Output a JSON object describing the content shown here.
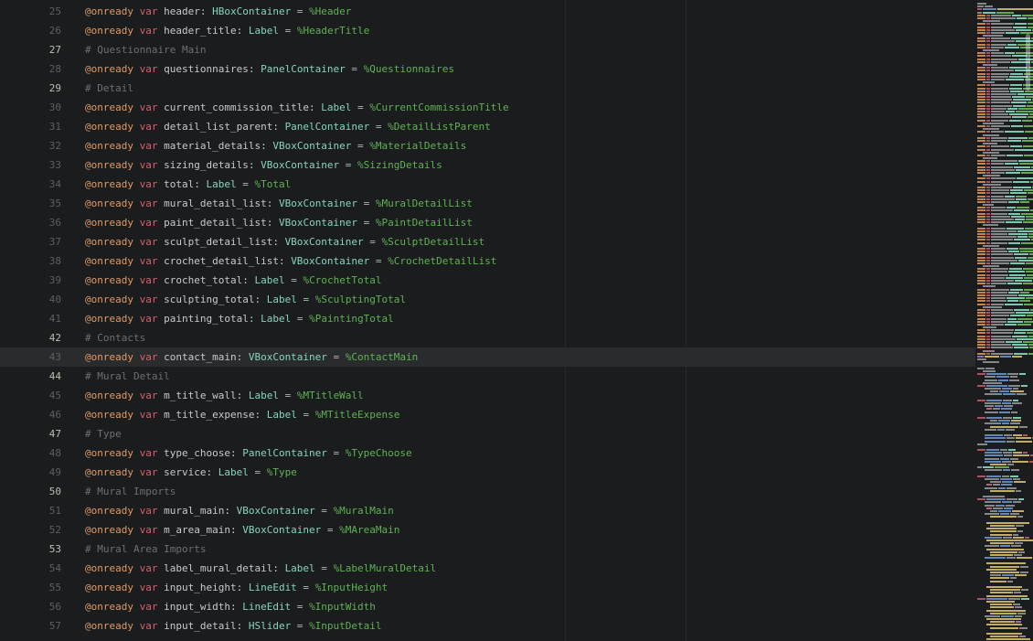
{
  "editor": {
    "current_line": 43,
    "lines": [
      {
        "n": 25,
        "tokens": [
          [
            "a",
            "@onready "
          ],
          [
            "k",
            "var "
          ],
          [
            "i",
            "header: "
          ],
          [
            "t",
            "HBoxContainer"
          ],
          [
            "o",
            " = "
          ],
          [
            "r",
            "%Header"
          ]
        ]
      },
      {
        "n": 26,
        "tokens": [
          [
            "a",
            "@onready "
          ],
          [
            "k",
            "var "
          ],
          [
            "i",
            "header_title: "
          ],
          [
            "t",
            "Label"
          ],
          [
            "o",
            " = "
          ],
          [
            "r",
            "%HeaderTitle"
          ]
        ]
      },
      {
        "n": 27,
        "tokens": [
          [
            "m",
            "# Questionnaire Main"
          ]
        ]
      },
      {
        "n": 28,
        "tokens": [
          [
            "a",
            "@onready "
          ],
          [
            "k",
            "var "
          ],
          [
            "i",
            "questionnaires: "
          ],
          [
            "t",
            "PanelContainer"
          ],
          [
            "o",
            " = "
          ],
          [
            "r",
            "%Questionnaires"
          ]
        ]
      },
      {
        "n": 29,
        "tokens": [
          [
            "m",
            "# Detail"
          ]
        ]
      },
      {
        "n": 30,
        "tokens": [
          [
            "a",
            "@onready "
          ],
          [
            "k",
            "var "
          ],
          [
            "i",
            "current_commission_title: "
          ],
          [
            "t",
            "Label"
          ],
          [
            "o",
            " = "
          ],
          [
            "r",
            "%CurrentCommissionTitle"
          ]
        ]
      },
      {
        "n": 31,
        "tokens": [
          [
            "a",
            "@onready "
          ],
          [
            "k",
            "var "
          ],
          [
            "i",
            "detail_list_parent: "
          ],
          [
            "t",
            "PanelContainer"
          ],
          [
            "o",
            " = "
          ],
          [
            "r",
            "%DetailListParent"
          ]
        ]
      },
      {
        "n": 32,
        "tokens": [
          [
            "a",
            "@onready "
          ],
          [
            "k",
            "var "
          ],
          [
            "i",
            "material_details: "
          ],
          [
            "t",
            "VBoxContainer"
          ],
          [
            "o",
            " = "
          ],
          [
            "r",
            "%MaterialDetails"
          ]
        ]
      },
      {
        "n": 33,
        "tokens": [
          [
            "a",
            "@onready "
          ],
          [
            "k",
            "var "
          ],
          [
            "i",
            "sizing_details: "
          ],
          [
            "t",
            "VBoxContainer"
          ],
          [
            "o",
            " = "
          ],
          [
            "r",
            "%SizingDetails"
          ]
        ]
      },
      {
        "n": 34,
        "tokens": [
          [
            "a",
            "@onready "
          ],
          [
            "k",
            "var "
          ],
          [
            "i",
            "total: "
          ],
          [
            "t",
            "Label"
          ],
          [
            "o",
            " = "
          ],
          [
            "r",
            "%Total"
          ]
        ]
      },
      {
        "n": 35,
        "tokens": [
          [
            "a",
            "@onready "
          ],
          [
            "k",
            "var "
          ],
          [
            "i",
            "mural_detail_list: "
          ],
          [
            "t",
            "VBoxContainer"
          ],
          [
            "o",
            " = "
          ],
          [
            "r",
            "%MuralDetailList"
          ]
        ]
      },
      {
        "n": 36,
        "tokens": [
          [
            "a",
            "@onready "
          ],
          [
            "k",
            "var "
          ],
          [
            "i",
            "paint_detail_list: "
          ],
          [
            "t",
            "VBoxContainer"
          ],
          [
            "o",
            " = "
          ],
          [
            "r",
            "%PaintDetailList"
          ]
        ]
      },
      {
        "n": 37,
        "tokens": [
          [
            "a",
            "@onready "
          ],
          [
            "k",
            "var "
          ],
          [
            "i",
            "sculpt_detail_list: "
          ],
          [
            "t",
            "VBoxContainer"
          ],
          [
            "o",
            " = "
          ],
          [
            "r",
            "%SculptDetailList"
          ]
        ]
      },
      {
        "n": 38,
        "tokens": [
          [
            "a",
            "@onready "
          ],
          [
            "k",
            "var "
          ],
          [
            "i",
            "crochet_detail_list: "
          ],
          [
            "t",
            "VBoxContainer"
          ],
          [
            "o",
            " = "
          ],
          [
            "r",
            "%CrochetDetailList"
          ]
        ]
      },
      {
        "n": 39,
        "tokens": [
          [
            "a",
            "@onready "
          ],
          [
            "k",
            "var "
          ],
          [
            "i",
            "crochet_total: "
          ],
          [
            "t",
            "Label"
          ],
          [
            "o",
            " = "
          ],
          [
            "r",
            "%CrochetTotal"
          ]
        ]
      },
      {
        "n": 40,
        "tokens": [
          [
            "a",
            "@onready "
          ],
          [
            "k",
            "var "
          ],
          [
            "i",
            "sculpting_total: "
          ],
          [
            "t",
            "Label"
          ],
          [
            "o",
            " = "
          ],
          [
            "r",
            "%SculptingTotal"
          ]
        ]
      },
      {
        "n": 41,
        "tokens": [
          [
            "a",
            "@onready "
          ],
          [
            "k",
            "var "
          ],
          [
            "i",
            "painting_total: "
          ],
          [
            "t",
            "Label"
          ],
          [
            "o",
            " = "
          ],
          [
            "r",
            "%PaintingTotal"
          ]
        ]
      },
      {
        "n": 42,
        "tokens": [
          [
            "m",
            "# Contacts"
          ]
        ]
      },
      {
        "n": 43,
        "tokens": [
          [
            "a",
            "@onready "
          ],
          [
            "k",
            "var "
          ],
          [
            "i",
            "contact_main: "
          ],
          [
            "t",
            "VBoxContainer"
          ],
          [
            "o",
            " = "
          ],
          [
            "r",
            "%ContactMain"
          ]
        ]
      },
      {
        "n": 44,
        "tokens": [
          [
            "m",
            "# Mural Detail"
          ]
        ]
      },
      {
        "n": 45,
        "tokens": [
          [
            "a",
            "@onready "
          ],
          [
            "k",
            "var "
          ],
          [
            "i",
            "m_title_wall: "
          ],
          [
            "t",
            "Label"
          ],
          [
            "o",
            " = "
          ],
          [
            "r",
            "%MTitleWall"
          ]
        ]
      },
      {
        "n": 46,
        "tokens": [
          [
            "a",
            "@onready "
          ],
          [
            "k",
            "var "
          ],
          [
            "i",
            "m_title_expense: "
          ],
          [
            "t",
            "Label"
          ],
          [
            "o",
            " = "
          ],
          [
            "r",
            "%MTitleExpense"
          ]
        ]
      },
      {
        "n": 47,
        "tokens": [
          [
            "m",
            "# Type"
          ]
        ]
      },
      {
        "n": 48,
        "tokens": [
          [
            "a",
            "@onready "
          ],
          [
            "k",
            "var "
          ],
          [
            "i",
            "type_choose: "
          ],
          [
            "t",
            "PanelContainer"
          ],
          [
            "o",
            " = "
          ],
          [
            "r",
            "%TypeChoose"
          ]
        ]
      },
      {
        "n": 49,
        "tokens": [
          [
            "a",
            "@onready "
          ],
          [
            "k",
            "var "
          ],
          [
            "i",
            "service: "
          ],
          [
            "t",
            "Label"
          ],
          [
            "o",
            " = "
          ],
          [
            "r",
            "%Type"
          ]
        ]
      },
      {
        "n": 50,
        "tokens": [
          [
            "m",
            "# Mural Imports"
          ]
        ]
      },
      {
        "n": 51,
        "tokens": [
          [
            "a",
            "@onready "
          ],
          [
            "k",
            "var "
          ],
          [
            "i",
            "mural_main: "
          ],
          [
            "t",
            "VBoxContainer"
          ],
          [
            "o",
            " = "
          ],
          [
            "r",
            "%MuralMain"
          ]
        ]
      },
      {
        "n": 52,
        "tokens": [
          [
            "a",
            "@onready "
          ],
          [
            "k",
            "var "
          ],
          [
            "i",
            "m_area_main: "
          ],
          [
            "t",
            "VBoxContainer"
          ],
          [
            "o",
            " = "
          ],
          [
            "r",
            "%MAreaMain"
          ]
        ]
      },
      {
        "n": 53,
        "tokens": [
          [
            "m",
            "# Mural Area Imports"
          ]
        ]
      },
      {
        "n": 54,
        "tokens": [
          [
            "a",
            "@onready "
          ],
          [
            "k",
            "var "
          ],
          [
            "i",
            "label_mural_detail: "
          ],
          [
            "t",
            "Label"
          ],
          [
            "o",
            " = "
          ],
          [
            "r",
            "%LabelMuralDetail"
          ]
        ]
      },
      {
        "n": 55,
        "tokens": [
          [
            "a",
            "@onready "
          ],
          [
            "k",
            "var "
          ],
          [
            "i",
            "input_height: "
          ],
          [
            "t",
            "LineEdit"
          ],
          [
            "o",
            " = "
          ],
          [
            "r",
            "%InputHeight"
          ]
        ]
      },
      {
        "n": 56,
        "tokens": [
          [
            "a",
            "@onready "
          ],
          [
            "k",
            "var "
          ],
          [
            "i",
            "input_width: "
          ],
          [
            "t",
            "LineEdit"
          ],
          [
            "o",
            " = "
          ],
          [
            "r",
            "%InputWidth"
          ]
        ]
      },
      {
        "n": 57,
        "tokens": [
          [
            "a",
            "@onready "
          ],
          [
            "k",
            "var "
          ],
          [
            "i",
            "input_detail: "
          ],
          [
            "t",
            "HSlider"
          ],
          [
            "o",
            " = "
          ],
          [
            "r",
            "%InputDetail"
          ]
        ]
      }
    ]
  },
  "colors": {
    "background": "#1b1c1e",
    "current_line_bg": "#2a2b2d",
    "guideline": "#27282b",
    "annotation": "#e09a63",
    "keyword": "#d5616e",
    "identifier": "#c7c9cc",
    "type": "#86d5bc",
    "operator": "#a9b8b0",
    "node_ref": "#5fb254",
    "comment": "#6b7075",
    "line_number": "#596062",
    "line_number_safe": "#b2c2ad"
  },
  "minimap": {
    "palette": {
      "o": "#c4854f",
      "r": "#b05261",
      "g": "#85888b",
      "t": "#7cc7b0",
      "n": "#66a952",
      "b": "#6186b8",
      "y": "#c2ad62",
      "p": "#7f75c0",
      "m": "#b85f86"
    },
    "rows": "gGxtoocoooocoooocoooocooooocooooooooooooocococoocoococooooocoocoooooocoooooocoooooocoooooocoooooocoooooocoooooocooooooocoSgcbGcdffcdfFfbdffpfbdFfyfbBBBgbdBBfBytfbdfFpfybcdffpFfybYyYyyBYyfYyyBbYyYyFyybYyyYdYyyYyfYyYybYyYyy"
  }
}
